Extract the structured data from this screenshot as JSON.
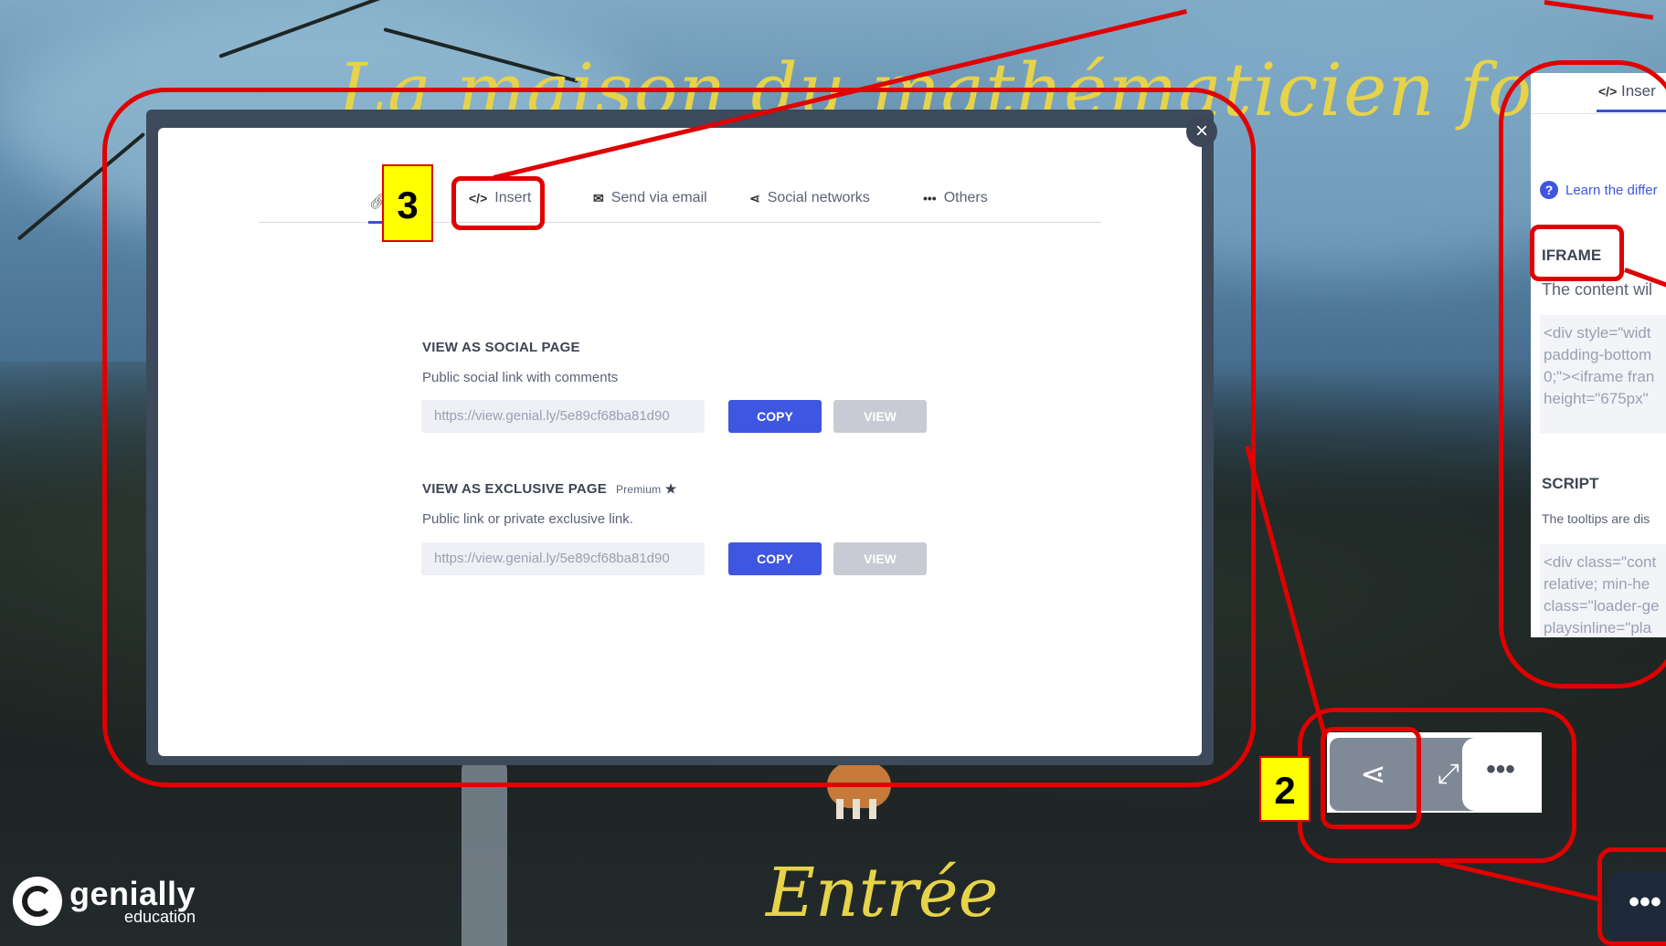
{
  "background": {
    "title": "La maison du mathématicien fou",
    "bottom_title": "Entrée"
  },
  "logo": {
    "name": "genially",
    "sub": "education"
  },
  "share_modal": {
    "close_glyph": "×",
    "tabs": [
      {
        "label": "Insert",
        "icon": "code-icon",
        "glyph": "</>"
      },
      {
        "label": "Send via email",
        "icon": "envelope-icon",
        "glyph": "✉"
      },
      {
        "label": "Social networks",
        "icon": "share-icon",
        "glyph": "⋖"
      },
      {
        "label": "Others",
        "icon": "more-dots-icon",
        "glyph": "•••"
      }
    ],
    "social_page": {
      "title": "VIEW AS SOCIAL PAGE",
      "description": "Public social link with comments",
      "url": "https://view.genial.ly/5e89cf68ba81d90",
      "copy_label": "COPY",
      "view_label": "VIEW"
    },
    "exclusive_page": {
      "title": "VIEW AS EXCLUSIVE PAGE",
      "badge": "Premium",
      "description": "Public link or private exclusive link.",
      "url": "https://view.genial.ly/5e89cf68ba81d90",
      "copy_label": "COPY",
      "view_label": "VIEW"
    }
  },
  "insert_panel": {
    "tab_label": "Inser",
    "help_link": "Learn the differ",
    "iframe_heading": "IFRAME",
    "iframe_desc": "The content wil",
    "iframe_code": [
      "<div style=\"widt",
      "padding-bottom",
      "0;\"><iframe fran",
      "height=\"675px\""
    ],
    "script_heading": "SCRIPT",
    "script_desc": "The tooltips are dis",
    "script_code": [
      "<div class=\"cont",
      "relative; min-he",
      "class=\"loader-ge",
      "playsinline=\"pla"
    ]
  },
  "toolbar": {
    "more_glyph": "•••",
    "share_glyph": "⋖",
    "fullscreen_glyph": "⤢"
  },
  "annotations": {
    "step2": "2",
    "step3": "3",
    "color": "#e00000",
    "badge_color": "#ffff00"
  },
  "dots_button": "•••"
}
